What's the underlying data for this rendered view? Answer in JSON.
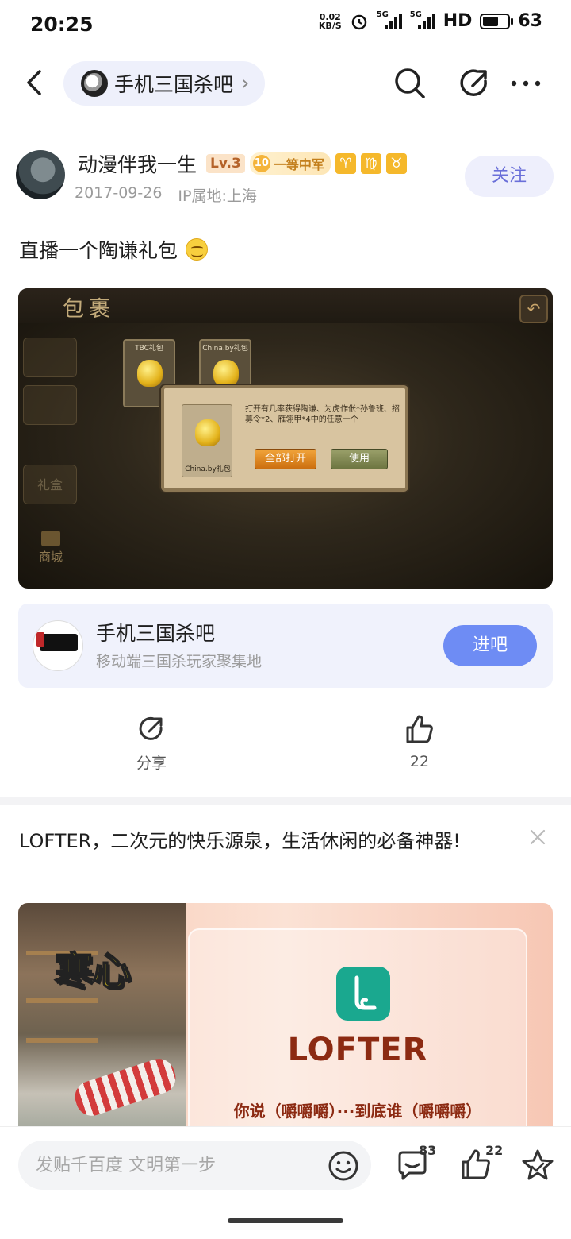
{
  "status_bar": {
    "time": "20:25",
    "net_speed_top": "0.02",
    "net_speed_bottom": "KB/S",
    "sim1": "5G",
    "sim2": "5G",
    "hd": "HD",
    "battery_percent": "63",
    "battery_level": 0.63,
    "icons": [
      "alarm-icon",
      "signal-icon",
      "signal-icon",
      "battery-icon"
    ]
  },
  "nav": {
    "forum_name": "手机三国杀吧",
    "chevron": "›",
    "icons": [
      "back-icon",
      "search-icon",
      "share-icon",
      "more-icon"
    ]
  },
  "author": {
    "name": "动漫伴我一生",
    "level": "Lv.3",
    "rank_num": "10",
    "rank_title": "一等中军",
    "zodiac": [
      "♈",
      "♍",
      "♉"
    ],
    "date": "2017-09-26",
    "ip_location": "IP属地:上海",
    "follow_label": "关注"
  },
  "post": {
    "text": "直播一个陶谦礼包",
    "image": {
      "title": "包裹",
      "side_tabs": [
        "",
        "",
        "礼盒",
        ""
      ],
      "shop_label": "商城",
      "slot_labels": [
        "TBC礼包",
        "China.by礼包"
      ],
      "dialog_text": "打开有几率获得陶谦、为虎作伥*孙鲁班、招募令*2、雁翎甲*4中的任意一个",
      "dialog_item_label": "China.by礼包",
      "open_all_label": "全部打开",
      "use_label": "使用"
    }
  },
  "forum_card": {
    "name": "手机三国杀吧",
    "description": "移动端三国杀玩家聚集地",
    "enter_label": "进吧"
  },
  "actions": {
    "share_label": "分享",
    "like_count": "22"
  },
  "ad": {
    "title": "LOFTER，二次元的快乐源泉，生活休闲的必备神器!",
    "caption": "寒心",
    "brand": "LOFTER",
    "slogan": "你说（嚼嚼嚼）···到底谁（嚼嚼嚼）"
  },
  "bottom_bar": {
    "reply_placeholder": "发贴千百度 文明第一步",
    "comment_count": "83",
    "like_count": "22"
  },
  "colors": {
    "accent": "#6e8cf4",
    "follow_text": "#6a6fd9",
    "card_bg": "#f0f2fc",
    "brand_red": "#8c2a12",
    "lofter_green": "#1aa88f"
  }
}
